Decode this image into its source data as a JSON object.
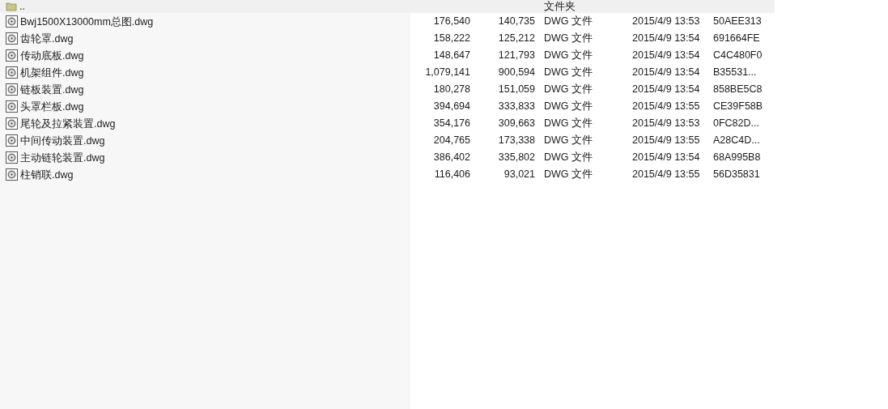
{
  "rows": [
    {
      "kind": "folder",
      "name": "..",
      "type": "文件夹"
    },
    {
      "kind": "file",
      "name": "Bwj1500X13000mm总图.dwg",
      "size": "176,540",
      "packed": "140,735",
      "type": "DWG 文件",
      "modified": "2015/4/9 13:53",
      "crc": "50AEE313"
    },
    {
      "kind": "file",
      "name": "齿轮罩.dwg",
      "size": "158,222",
      "packed": "125,212",
      "type": "DWG 文件",
      "modified": "2015/4/9 13:54",
      "crc": "691664FE"
    },
    {
      "kind": "file",
      "name": "传动底板.dwg",
      "size": "148,647",
      "packed": "121,793",
      "type": "DWG 文件",
      "modified": "2015/4/9 13:54",
      "crc": "C4C480F0"
    },
    {
      "kind": "file",
      "name": "机架组件.dwg",
      "size": "1,079,141",
      "packed": "900,594",
      "type": "DWG 文件",
      "modified": "2015/4/9 13:54",
      "crc": "B35531..."
    },
    {
      "kind": "file",
      "name": "链板装置.dwg",
      "size": "180,278",
      "packed": "151,059",
      "type": "DWG 文件",
      "modified": "2015/4/9 13:54",
      "crc": "858BE5C8"
    },
    {
      "kind": "file",
      "name": "头罩栏板.dwg",
      "size": "394,694",
      "packed": "333,833",
      "type": "DWG 文件",
      "modified": "2015/4/9 13:55",
      "crc": "CE39F58B"
    },
    {
      "kind": "file",
      "name": "尾轮及拉紧装置.dwg",
      "size": "354,176",
      "packed": "309,663",
      "type": "DWG 文件",
      "modified": "2015/4/9 13:53",
      "crc": "0FC82D..."
    },
    {
      "kind": "file",
      "name": "中间传动装置.dwg",
      "size": "204,765",
      "packed": "173,338",
      "type": "DWG 文件",
      "modified": "2015/4/9 13:55",
      "crc": "A28C4D..."
    },
    {
      "kind": "file",
      "name": "主动链轮装置.dwg",
      "size": "386,402",
      "packed": "335,802",
      "type": "DWG 文件",
      "modified": "2015/4/9 13:54",
      "crc": "68A995B8"
    },
    {
      "kind": "file",
      "name": "柱销联.dwg",
      "size": "116,406",
      "packed": "93,021",
      "type": "DWG 文件",
      "modified": "2015/4/9 13:55",
      "crc": "56D35831"
    }
  ]
}
